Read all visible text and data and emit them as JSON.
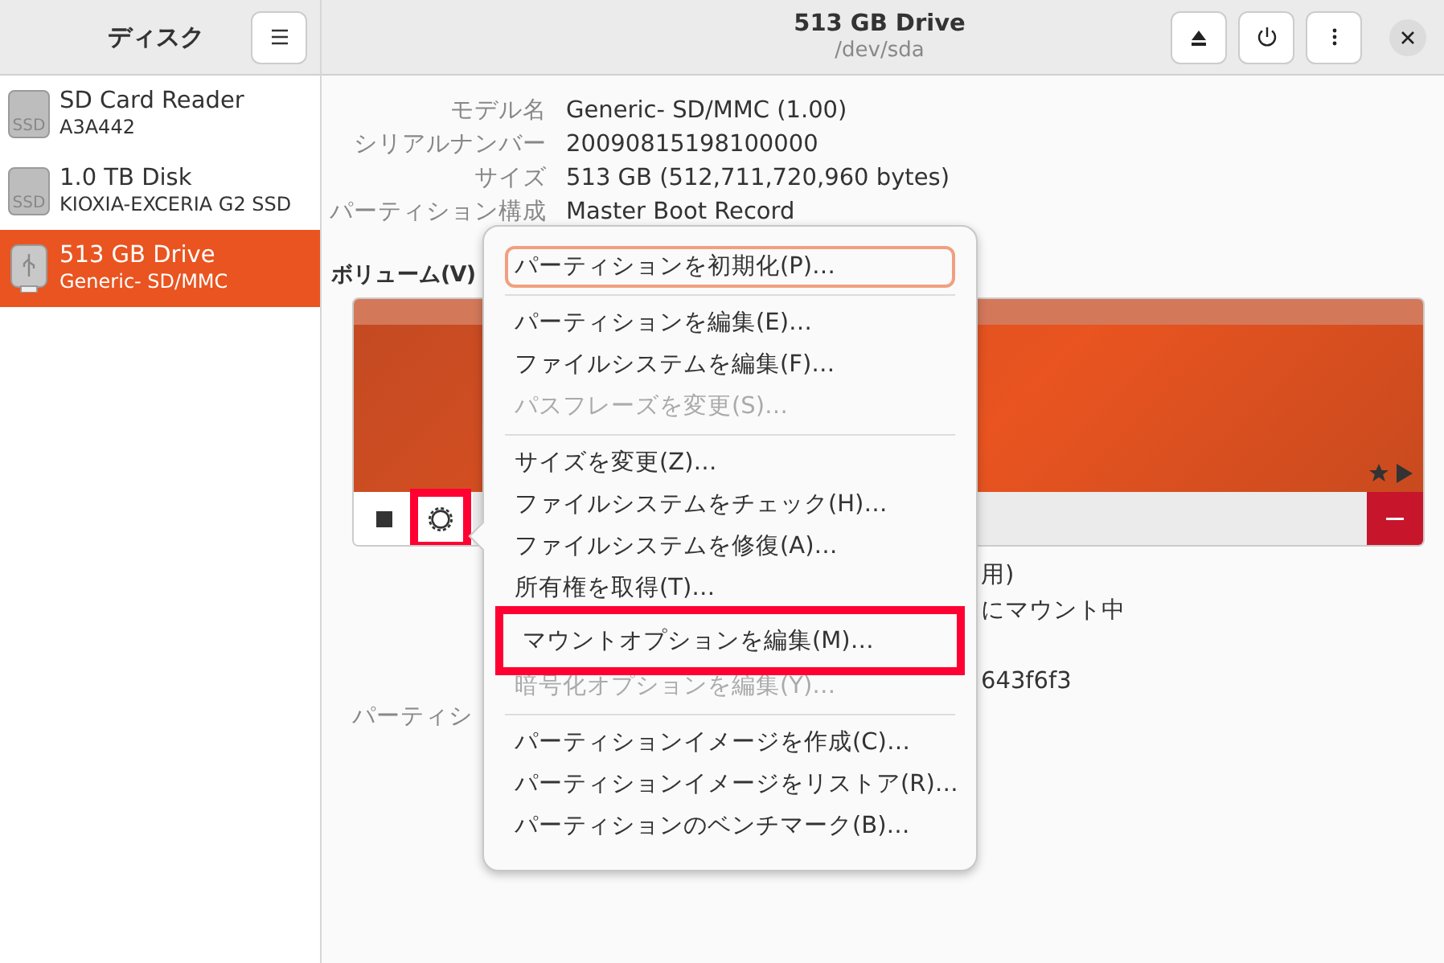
{
  "sidebar": {
    "title": "ディスク",
    "items": [
      {
        "name": "SD Card Reader",
        "detail": "A3A442",
        "kind": "ssd",
        "icon_text": "SSD",
        "selected": false
      },
      {
        "name": "1.0 TB Disk",
        "detail": "KIOXIA-EXCERIA G2 SSD",
        "kind": "ssd",
        "icon_text": "SSD",
        "selected": false
      },
      {
        "name": "513 GB Drive",
        "detail": "Generic- SD/MMC",
        "kind": "usb",
        "selected": true
      }
    ]
  },
  "header": {
    "title": "513 GB Drive",
    "subtitle": "/dev/sda"
  },
  "drive_info": [
    {
      "label": "モデル名",
      "value": "Generic- SD/MMC (1.00)"
    },
    {
      "label": "シリアルナンバー",
      "value": "20090815198100000"
    },
    {
      "label": "サイズ",
      "value": "513 GB (512,711,720,960 bytes)"
    },
    {
      "label": "パーティション構成",
      "value": "Master Boot Record"
    }
  ],
  "volumes": {
    "heading": "ボリューム(V)",
    "gear_highlighted": true,
    "partition_info": [
      {
        "kind": "value",
        "text": "用)"
      },
      {
        "kind": "value",
        "text": "にマウント中"
      },
      {
        "kind": "blank"
      },
      {
        "kind": "value",
        "text": "643f6f3"
      },
      {
        "kind": "label",
        "text": "パーティシ"
      }
    ]
  },
  "menu": {
    "items": [
      {
        "kind": "item",
        "label": "パーティションを初期化(P)…",
        "focused": true,
        "disabled": false,
        "highlighted": false
      },
      {
        "kind": "separator"
      },
      {
        "kind": "item",
        "label": "パーティションを編集(E)…",
        "focused": false,
        "disabled": false,
        "highlighted": false
      },
      {
        "kind": "item",
        "label": "ファイルシステムを編集(F)…",
        "focused": false,
        "disabled": false,
        "highlighted": false
      },
      {
        "kind": "item",
        "label": "パスフレーズを変更(S)…",
        "focused": false,
        "disabled": true,
        "highlighted": false
      },
      {
        "kind": "separator"
      },
      {
        "kind": "item",
        "label": "サイズを変更(Z)…",
        "focused": false,
        "disabled": false,
        "highlighted": false
      },
      {
        "kind": "item",
        "label": "ファイルシステムをチェック(H)…",
        "focused": false,
        "disabled": false,
        "highlighted": false
      },
      {
        "kind": "item",
        "label": "ファイルシステムを修復(A)…",
        "focused": false,
        "disabled": false,
        "highlighted": false
      },
      {
        "kind": "item",
        "label": "所有権を取得(T)…",
        "focused": false,
        "disabled": false,
        "highlighted": false
      },
      {
        "kind": "item",
        "label": "マウントオプションを編集(M)…",
        "focused": false,
        "disabled": false,
        "highlighted": true
      },
      {
        "kind": "item",
        "label": "暗号化オプションを編集(Y)…",
        "focused": false,
        "disabled": true,
        "highlighted": false
      },
      {
        "kind": "separator"
      },
      {
        "kind": "item",
        "label": "パーティションイメージを作成(C)…",
        "focused": false,
        "disabled": false,
        "highlighted": false
      },
      {
        "kind": "item",
        "label": "パーティションイメージをリストア(R)…",
        "focused": false,
        "disabled": false,
        "highlighted": false
      },
      {
        "kind": "item",
        "label": "パーティションのベンチマーク(B)…",
        "focused": false,
        "disabled": false,
        "highlighted": false
      }
    ]
  }
}
